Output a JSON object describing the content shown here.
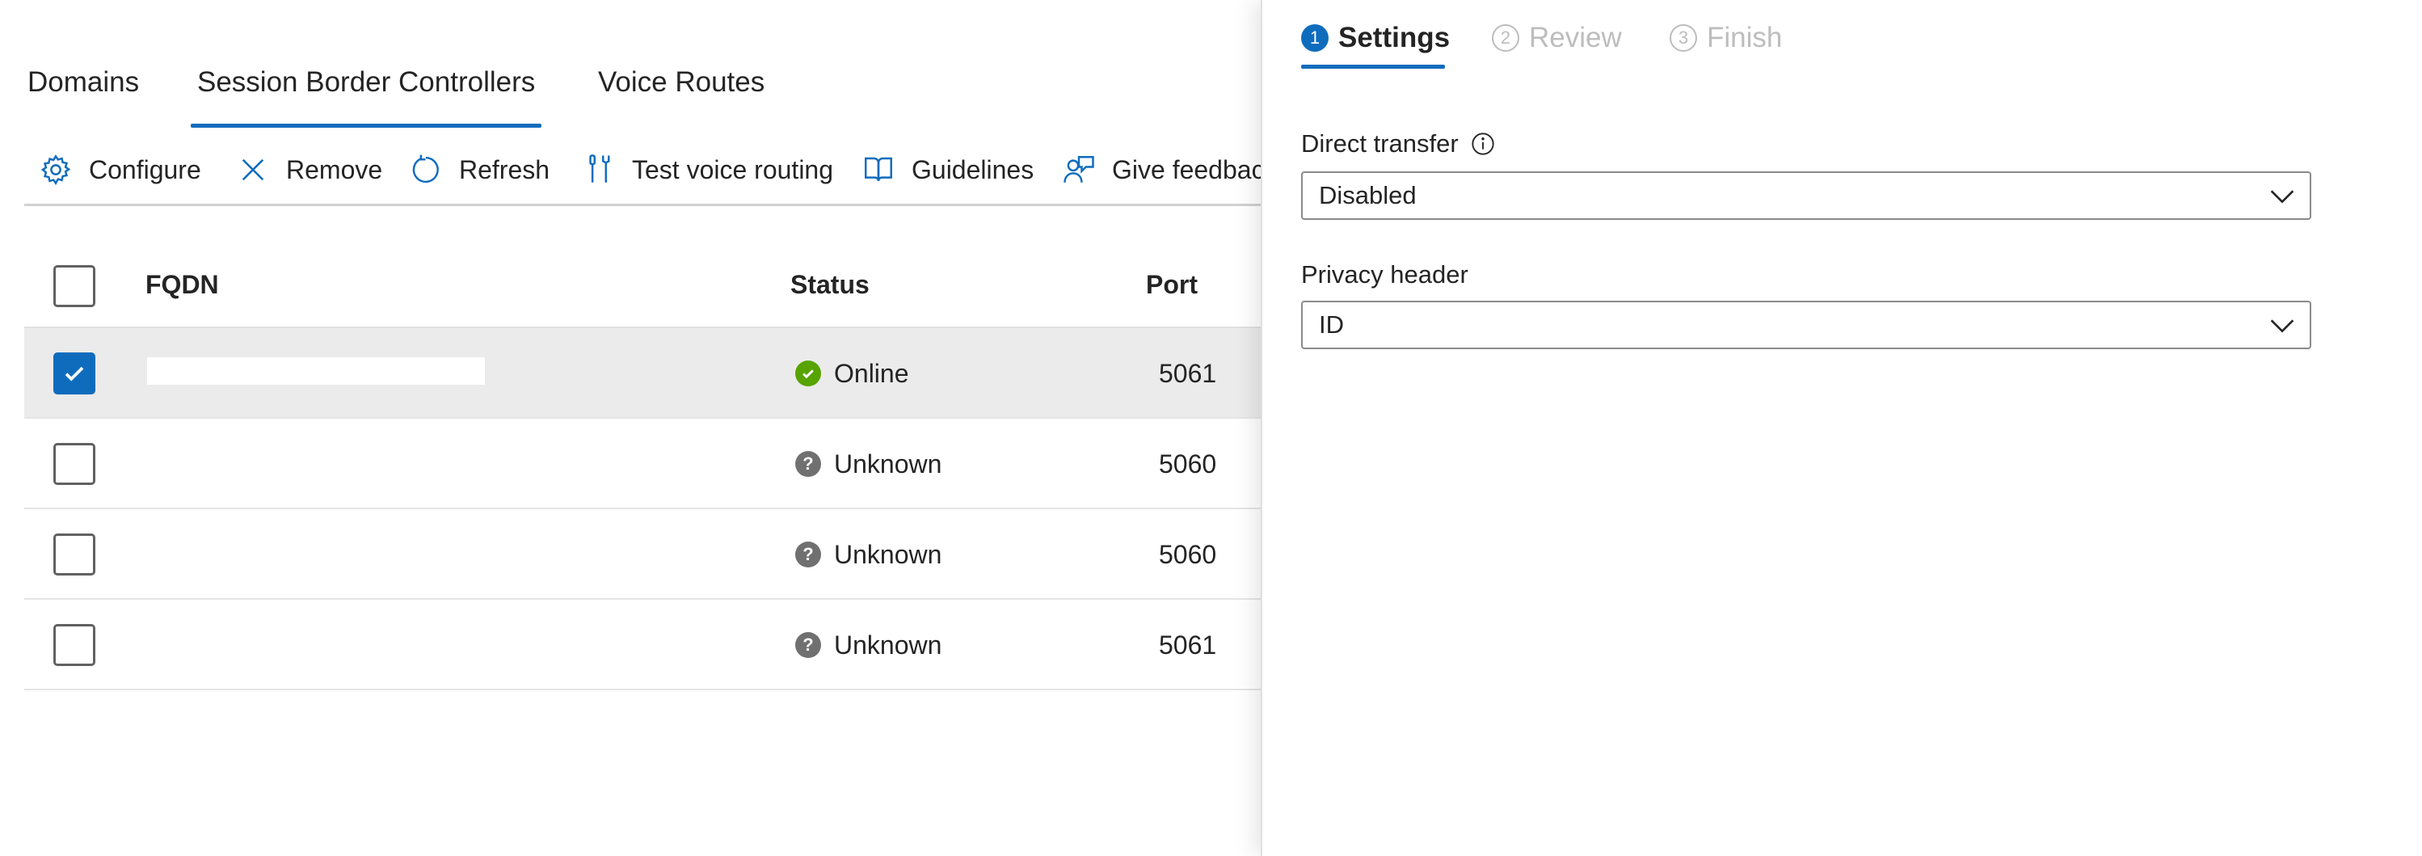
{
  "tabs": [
    {
      "label": "Domains"
    },
    {
      "label": "Session Border Controllers",
      "active": true
    },
    {
      "label": "Voice Routes"
    }
  ],
  "toolbar": {
    "configure": "Configure",
    "remove": "Remove",
    "refresh": "Refresh",
    "test_voice_routing": "Test voice routing",
    "guidelines": "Guidelines",
    "give_feedback": "Give feedbac"
  },
  "table": {
    "columns": {
      "fqdn": "FQDN",
      "status": "Status",
      "port": "Port"
    },
    "rows": [
      {
        "selected": true,
        "status": "Online",
        "status_icon": "check-circle-icon",
        "port": "5061"
      },
      {
        "selected": false,
        "status": "Unknown",
        "status_icon": "question-circle-icon",
        "port": "5060"
      },
      {
        "selected": false,
        "status": "Unknown",
        "status_icon": "question-circle-icon",
        "port": "5060"
      },
      {
        "selected": false,
        "status": "Unknown",
        "status_icon": "question-circle-icon",
        "port": "5061"
      }
    ]
  },
  "wizard": {
    "steps": [
      {
        "num": "1",
        "label": "Settings",
        "state": "active"
      },
      {
        "num": "2",
        "label": "Review",
        "state": "inactive"
      },
      {
        "num": "3",
        "label": "Finish",
        "state": "inactive"
      }
    ]
  },
  "form": {
    "direct_transfer": {
      "label": "Direct transfer",
      "value": "Disabled"
    },
    "privacy_header": {
      "label": "Privacy header",
      "value": "ID"
    }
  },
  "colors": {
    "accent": "#0f6cbd",
    "online": "#57a300",
    "unknown": "#707070",
    "selected_row": "#ebebeb",
    "inactive_text": "#bdbdbd"
  }
}
